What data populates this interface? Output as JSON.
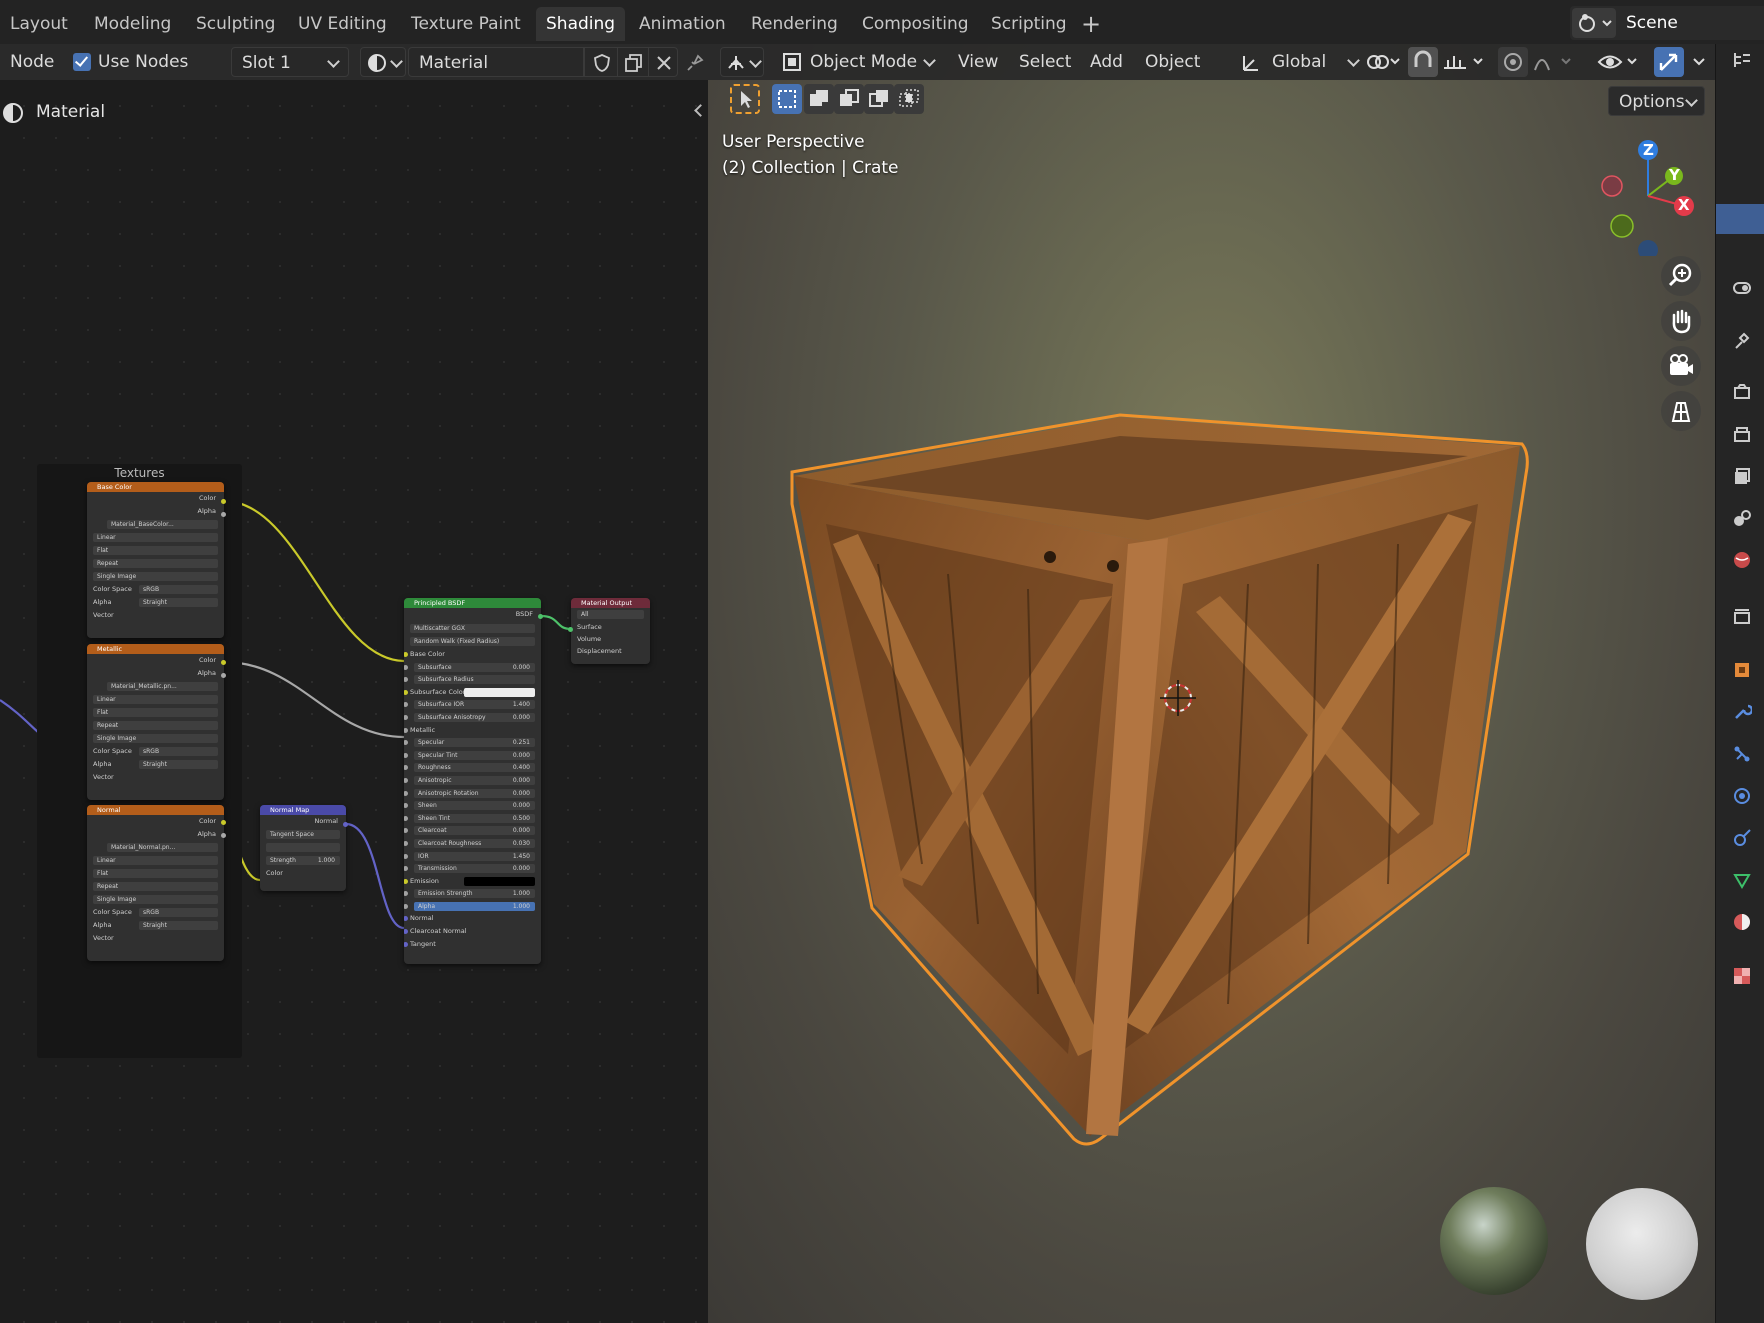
{
  "workspace_tabs": [
    "Layout",
    "Modeling",
    "Sculpting",
    "UV Editing",
    "Texture Paint",
    "Shading",
    "Animation",
    "Rendering",
    "Compositing",
    "Scripting"
  ],
  "active_tab": "Shading",
  "scene": {
    "name": "Scene"
  },
  "node_editor": {
    "menu_node": "Node",
    "use_nodes_label": "Use Nodes",
    "use_nodes_checked": true,
    "slot": "Slot 1",
    "material_name": "Material",
    "breadcrumb": "Material",
    "frame_label": "Textures",
    "nodes": {
      "base_color": {
        "title": "Base Color",
        "out_color": "Color",
        "out_alpha": "Alpha",
        "image": "Material_BaseColor...",
        "interp": "Linear",
        "proj": "Flat",
        "ext": "Repeat",
        "source": "Single Image",
        "cs_label": "Color Space",
        "cs_value": "sRGB",
        "alpha_label": "Alpha",
        "alpha_value": "Straight",
        "vector": "Vector"
      },
      "metallic": {
        "title": "Metallic",
        "out_color": "Color",
        "out_alpha": "Alpha",
        "image": "Material_Metallic.pn...",
        "interp": "Linear",
        "proj": "Flat",
        "ext": "Repeat",
        "source": "Single Image",
        "cs_label": "Color Space",
        "cs_value": "sRGB",
        "alpha_label": "Alpha",
        "alpha_value": "Straight",
        "vector": "Vector"
      },
      "normal": {
        "title": "Normal",
        "out_color": "Color",
        "out_alpha": "Alpha",
        "image": "Material_Normal.pn...",
        "interp": "Linear",
        "proj": "Flat",
        "ext": "Repeat",
        "source": "Single Image",
        "cs_label": "Color Space",
        "cs_value": "sRGB",
        "alpha_label": "Alpha",
        "alpha_value": "Straight",
        "vector": "Vector"
      },
      "normal_map": {
        "title": "Normal Map",
        "out": "Normal",
        "space": "Tangent Space",
        "strength_label": "Strength",
        "strength_value": "1.000",
        "in_color": "Color"
      },
      "bsdf": {
        "title": "Principled BSDF",
        "out": "BSDF",
        "dist": "Multiscatter GGX",
        "sss_method": "Random Walk (Fixed Radius)",
        "rows": [
          {
            "label": "Base Color",
            "type": "socket"
          },
          {
            "label": "Subsurface",
            "value": "0.000",
            "type": "field"
          },
          {
            "label": "Subsurface Radius",
            "type": "dropdown"
          },
          {
            "label": "Subsurface Color",
            "type": "color"
          },
          {
            "label": "Subsurface IOR",
            "value": "1.400",
            "type": "field"
          },
          {
            "label": "Subsurface Anisotropy",
            "value": "0.000",
            "type": "field"
          },
          {
            "label": "Metallic",
            "type": "socket"
          },
          {
            "label": "Specular",
            "value": "0.251",
            "type": "field"
          },
          {
            "label": "Specular Tint",
            "value": "0.000",
            "type": "field"
          },
          {
            "label": "Roughness",
            "value": "0.400",
            "type": "field"
          },
          {
            "label": "Anisotropic",
            "value": "0.000",
            "type": "field"
          },
          {
            "label": "Anisotropic Rotation",
            "value": "0.000",
            "type": "field"
          },
          {
            "label": "Sheen",
            "value": "0.000",
            "type": "field"
          },
          {
            "label": "Sheen Tint",
            "value": "0.500",
            "type": "field"
          },
          {
            "label": "Clearcoat",
            "value": "0.000",
            "type": "field"
          },
          {
            "label": "Clearcoat Roughness",
            "value": "0.030",
            "type": "field"
          },
          {
            "label": "IOR",
            "value": "1.450",
            "type": "field"
          },
          {
            "label": "Transmission",
            "value": "0.000",
            "type": "field"
          },
          {
            "label": "Emission",
            "type": "black"
          },
          {
            "label": "Emission Strength",
            "value": "1.000",
            "type": "field"
          },
          {
            "label": "Alpha",
            "value": "1.000",
            "type": "blue"
          },
          {
            "label": "Normal",
            "type": "socket"
          },
          {
            "label": "Clearcoat Normal",
            "type": "socket"
          },
          {
            "label": "Tangent",
            "type": "socket"
          }
        ]
      },
      "output": {
        "title": "Material Output",
        "target": "All",
        "surface": "Surface",
        "volume": "Volume",
        "displacement": "Displacement"
      }
    }
  },
  "viewport": {
    "mode": "Object Mode",
    "menus": [
      "View",
      "Select",
      "Add",
      "Object"
    ],
    "orientation": "Global",
    "options": "Options",
    "perspective": "User Perspective",
    "collection": "(2) Collection | Crate",
    "gizmo": {
      "z": "Z",
      "y": "Y",
      "x": "X"
    }
  },
  "colors": {
    "accent": "#4772b3",
    "selection_outline": "#f0932b",
    "texture_header": "#b35d1a",
    "bsdf_header": "#2e8a3a",
    "output_header": "#6e2b3a",
    "normalmap_header": "#4a4aa8"
  }
}
